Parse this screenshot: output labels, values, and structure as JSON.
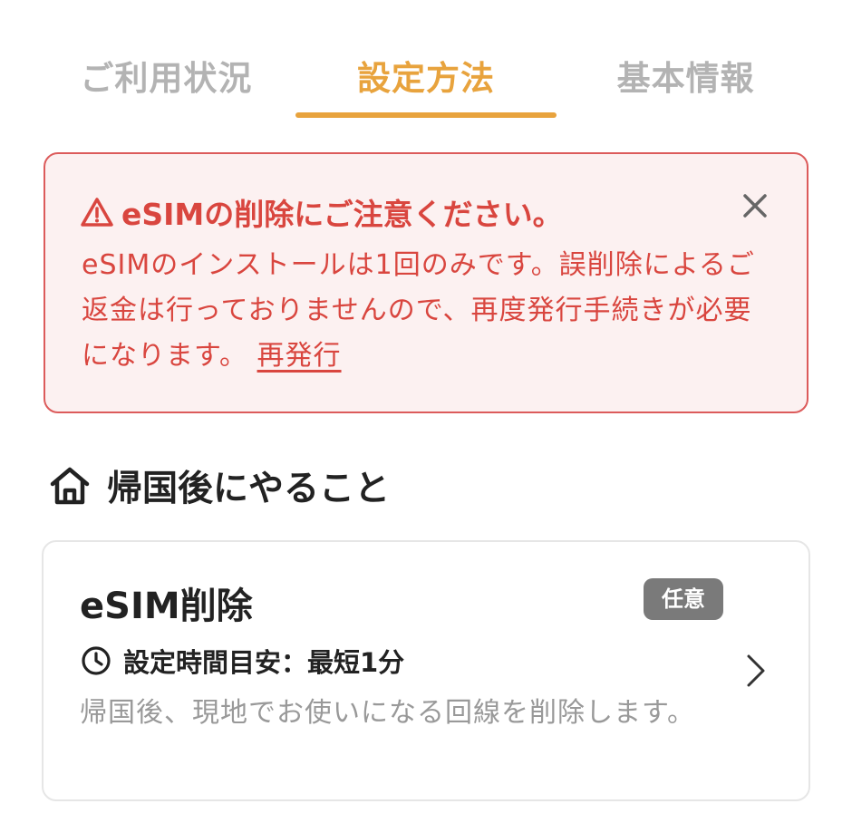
{
  "colors": {
    "accent": "#e8a33d",
    "tab_inactive": "#b3b3b3",
    "alert_red": "#d9463f",
    "alert_bg": "#fcf1f1",
    "badge_bg": "#7a7a7a"
  },
  "tabs": [
    {
      "label": "ご利用状況",
      "active": false
    },
    {
      "label": "設定方法",
      "active": true
    },
    {
      "label": "基本情報",
      "active": false
    }
  ],
  "alert": {
    "icon": "warning-icon",
    "title": "eSIMの削除にご注意ください。",
    "body": "eSIMのインストールは1回のみです。誤削除によるご返金は行っておりませんので、再度発行手続きが必要になります。",
    "link_label": "再発行",
    "close_icon": "close-icon"
  },
  "section": {
    "icon": "home-icon",
    "title": "帰国後にやること"
  },
  "card": {
    "title": "eSIM削除",
    "badge": "任意",
    "time_icon": "clock-icon",
    "time_label": "設定時間目安：最短1分",
    "description": "帰国後、現地でお使いになる回線を削除します。",
    "chevron_icon": "chevron-right-icon"
  }
}
